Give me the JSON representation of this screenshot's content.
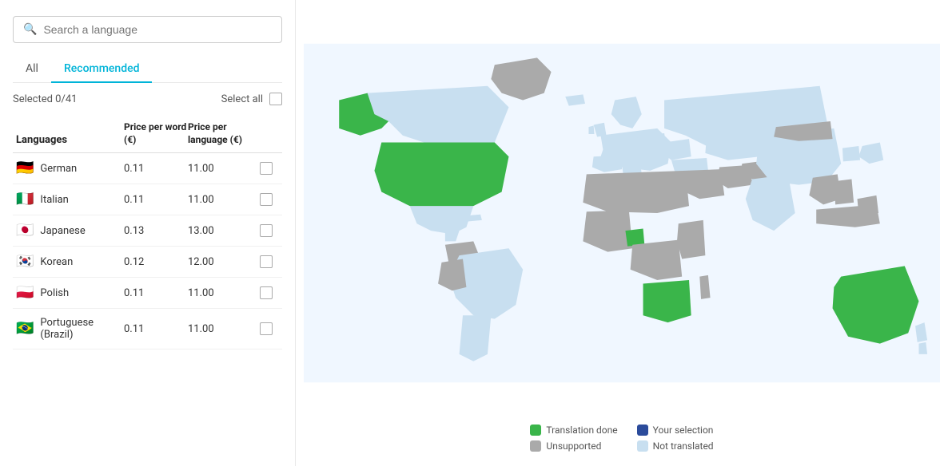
{
  "search": {
    "placeholder": "Search a language"
  },
  "tabs": [
    {
      "id": "all",
      "label": "All",
      "active": false
    },
    {
      "id": "recommended",
      "label": "Recommended",
      "active": true
    }
  ],
  "selection": {
    "label": "Selected 0/41",
    "select_all_label": "Select all"
  },
  "table": {
    "headers": {
      "language": "Languages",
      "price_word": "Price per word (€)",
      "price_lang": "Price per language (€)"
    },
    "rows": [
      {
        "flag": "🇩🇪",
        "name": "German",
        "price_word": "0.11",
        "price_lang": "11.00",
        "checked": false
      },
      {
        "flag": "🇮🇹",
        "name": "Italian",
        "price_word": "0.11",
        "price_lang": "11.00",
        "checked": false
      },
      {
        "flag": "🇯🇵",
        "name": "Japanese",
        "price_word": "0.13",
        "price_lang": "13.00",
        "checked": false
      },
      {
        "flag": "🇰🇷",
        "name": "Korean",
        "price_word": "0.12",
        "price_lang": "12.00",
        "checked": false
      },
      {
        "flag": "🇵🇱",
        "name": "Polish",
        "price_word": "0.11",
        "price_lang": "11.00",
        "checked": false
      },
      {
        "flag": "🇧🇷",
        "name": "Portuguese (Brazil)",
        "price_word": "0.11",
        "price_lang": "11.00",
        "checked": false
      }
    ]
  },
  "legend": {
    "items_left": [
      {
        "color": "#3ab54a",
        "label": "Translation done"
      },
      {
        "color": "#aaaaaa",
        "label": "Unsupported"
      }
    ],
    "items_right": [
      {
        "color": "#2b4b9b",
        "label": "Your selection"
      },
      {
        "color": "#c8dff0",
        "label": "Not translated"
      }
    ]
  },
  "colors": {
    "tab_active": "#00b4d8",
    "translation_done": "#3ab54a",
    "unsupported": "#aaaaaa",
    "your_selection": "#2b4b9b",
    "not_translated": "#c8dff0",
    "map_border": "#ffffff"
  }
}
